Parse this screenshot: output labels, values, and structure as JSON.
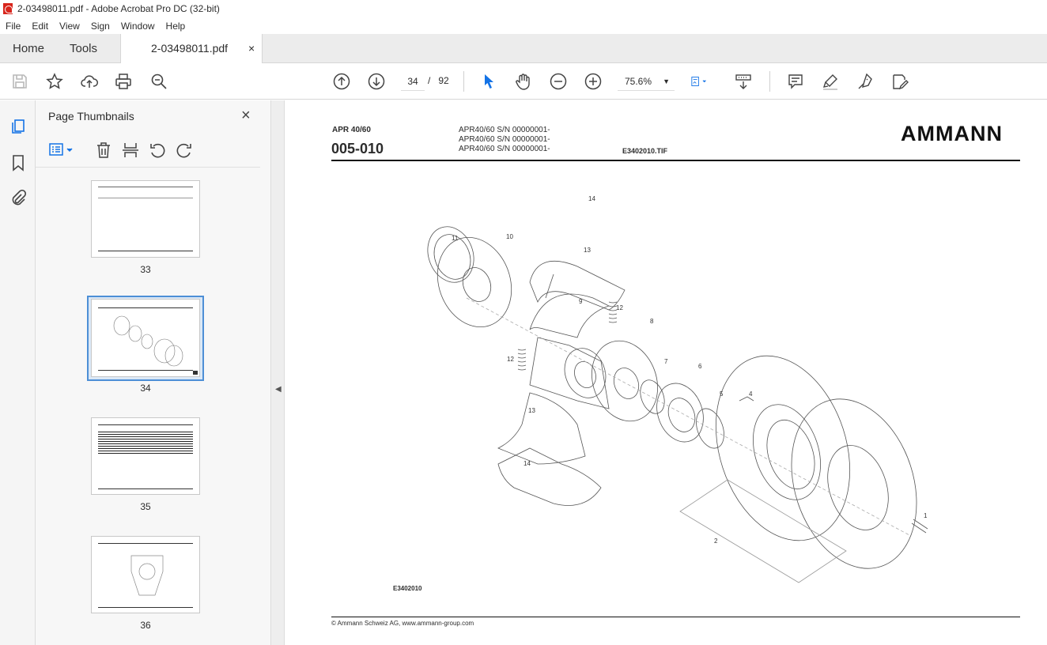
{
  "window": {
    "title": "2-03498011.pdf - Adobe Acrobat Pro DC (32-bit)"
  },
  "menu": [
    "File",
    "Edit",
    "View",
    "Sign",
    "Window",
    "Help"
  ],
  "tabs": {
    "home": "Home",
    "tools": "Tools",
    "document": "2-03498011.pdf",
    "close": "×"
  },
  "toolbar": {
    "current_page": "34",
    "page_separator": "/",
    "total_pages": "92",
    "zoom": "75.6%",
    "accent": "#1473e6"
  },
  "thumbnails": {
    "title": "Page Thumbnails",
    "close": "×",
    "pages": [
      {
        "number": "33",
        "selected": false
      },
      {
        "number": "34",
        "selected": true
      },
      {
        "number": "35",
        "selected": false
      },
      {
        "number": "36",
        "selected": false
      }
    ]
  },
  "page": {
    "model": "APR 40/60",
    "code": "005-010",
    "serials": [
      "APR40/60 S/N 00000001-",
      "APR40/60 S/N 00000001-",
      "APR40/60 S/N 00000001-"
    ],
    "tif": "E3402010.TIF",
    "logo": "AMMANN",
    "drawing_id": "E3402010",
    "footer": "© Ammann Schweiz AG, www.ammann-group.com",
    "callouts": [
      "14",
      "11",
      "10",
      "13",
      "9",
      "12",
      "8",
      "12",
      "7",
      "6",
      "5",
      "4",
      "13",
      "14",
      "1",
      "2"
    ]
  }
}
